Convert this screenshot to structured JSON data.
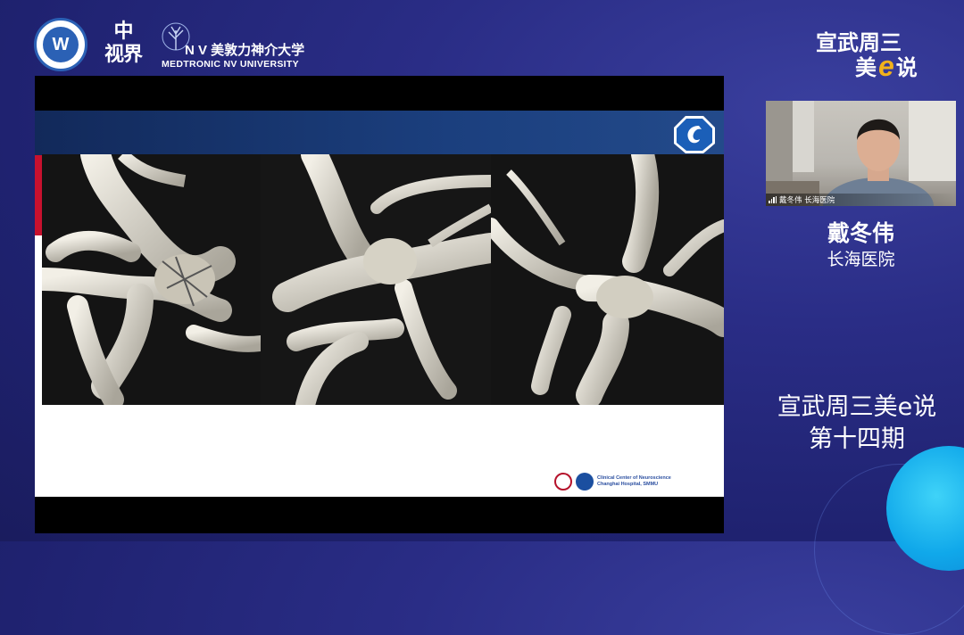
{
  "logos": {
    "badge_text": "W",
    "calligraphy": [
      "中",
      "视界"
    ],
    "nv_brand": "N V 美敦力神介大学",
    "nv_sub": "MEDTRONIC NV UNIVERSITY"
  },
  "brand": {
    "line1": "宣武周三",
    "line2_prefix": "美",
    "line2_e": "e",
    "line2_suffix": "说"
  },
  "slide": {
    "footer_text": [
      "Clinical Center of Neuroscience",
      "Changhai Hospital, SMMU"
    ]
  },
  "video": {
    "caption": "戴冬伟 长海医院"
  },
  "speaker": {
    "name": "戴冬伟",
    "org": "长海医院"
  },
  "episode": {
    "line1": "宣武周三美e说",
    "line2": "第十四期"
  },
  "colors": {
    "background": "#2a2d86",
    "accent_blue": "#10a8ea",
    "brand_e": "#f2b21b",
    "slide_header": "#1b3f7e",
    "slide_red": "#c8112e"
  }
}
